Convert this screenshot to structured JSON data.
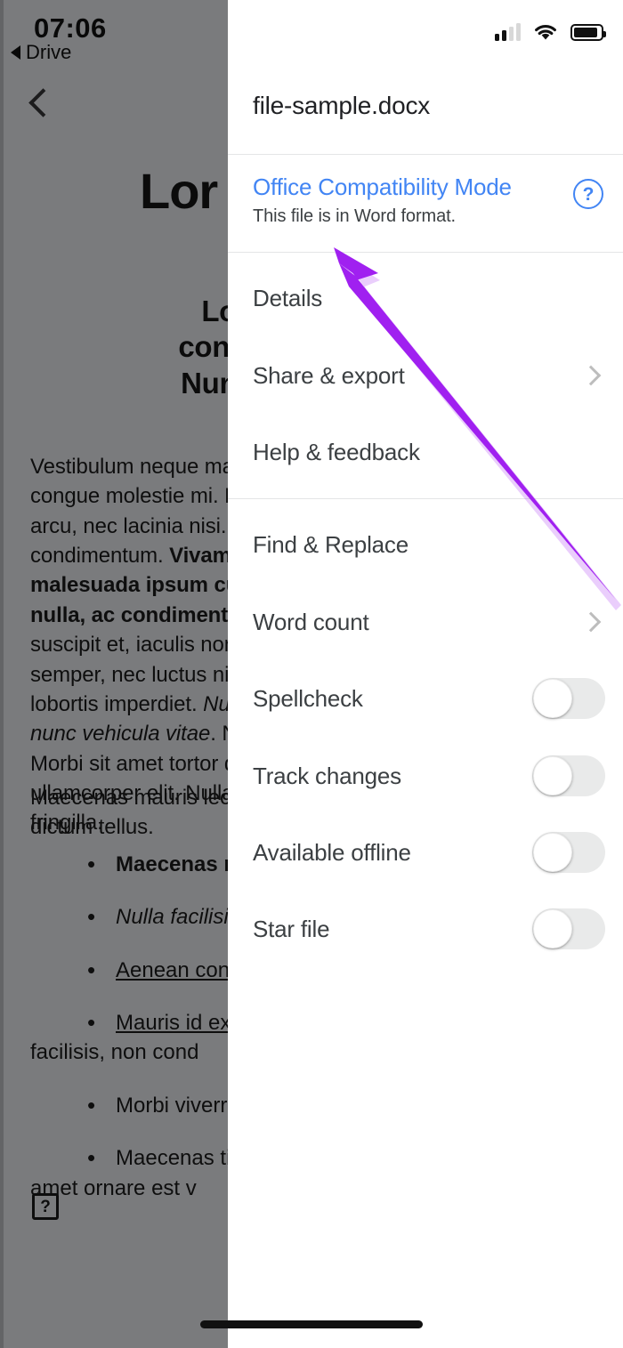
{
  "device": {
    "status_bar": {
      "time": "07:06",
      "back_label": "Drive",
      "back_icon": "triangle-left-icon",
      "signal_icon": "cellular-signal-icon",
      "signal_bars_filled": 2,
      "signal_bars_total": 4,
      "wifi_icon": "wifi-icon",
      "battery_icon": "battery-icon",
      "battery_level_percent": 88
    },
    "home_indicator": "home-indicator"
  },
  "background_document": {
    "back_button_icon": "chevron-left-icon",
    "heading_large": "Lor",
    "heading_block": "Lorem\nconsectet\nNunc ac f",
    "paragraph_1": "Vestibulum neque ma\ncongue molestie mi. P\narcu, nec lacinia nisi. U\ncondimentum. Vivamu\nmalesuada ipsum cu\nnulla, ac condimentu\nsuscipit et, iaculis non\nsemper, nec luctus nis\nlobortis imperdiet. Nul\nnunc vehicula vitae. N\nMorbi sit amet tortor q\nullamcorper elit. Nulla\nfringilla.",
    "paragraph_2": "Maecenas mauris lect\ndictum tellus.",
    "bullets": [
      "Maecenas n",
      "Nulla facilisi.",
      "Aenean cong",
      "Mauris id ex ",
      "Morbi viverra",
      "Maecenas ti"
    ],
    "bullet_continuations": {
      "4": "facilisis, non cond",
      "6": "amet ornare est v"
    },
    "help_box_icon": "help-square-icon",
    "help_box_label": "?"
  },
  "panel": {
    "file_name": "file-sample.docx",
    "compatibility": {
      "title": "Office Compatibility Mode",
      "subtitle": "This file is in Word format.",
      "help_icon": "help-circle-icon",
      "title_color": "#4285f4"
    },
    "sections": [
      {
        "items": [
          {
            "label": "Details",
            "type": "item",
            "accessory": "none"
          },
          {
            "label": "Share & export",
            "type": "item",
            "accessory": "chevron-right-icon"
          },
          {
            "label": "Help & feedback",
            "type": "item",
            "accessory": "none"
          }
        ]
      },
      {
        "items": [
          {
            "label": "Find & Replace",
            "type": "item",
            "accessory": "none"
          },
          {
            "label": "Word count",
            "type": "item",
            "accessory": "chevron-right-icon"
          },
          {
            "label": "Spellcheck",
            "type": "toggle",
            "value": "off"
          },
          {
            "label": "Track changes",
            "type": "toggle",
            "value": "off"
          },
          {
            "label": "Available offline",
            "type": "toggle",
            "value": "off"
          },
          {
            "label": "Star file",
            "type": "toggle",
            "value": "off"
          }
        ]
      }
    ]
  },
  "annotation": {
    "arrow_icon": "purple-arrow-annotation",
    "color": "#a020f0"
  }
}
